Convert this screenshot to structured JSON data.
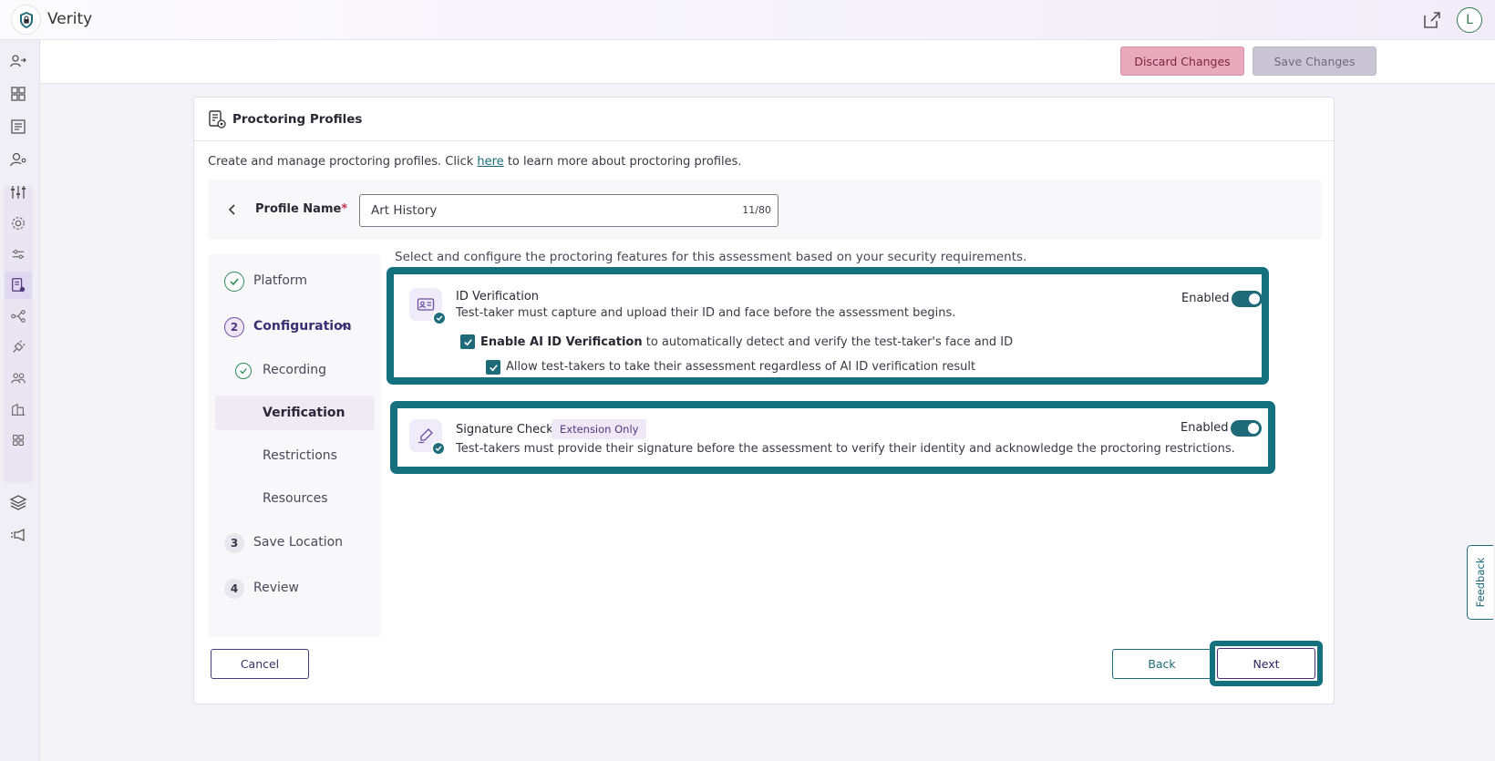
{
  "app": {
    "title": "Verity",
    "avatar_initial": "L"
  },
  "rail": {
    "items": [
      {
        "icon": "user-switch-icon"
      },
      {
        "icon": "grid-icon"
      },
      {
        "icon": "report-icon"
      },
      {
        "icon": "user-search-icon"
      },
      {
        "icon": "sliders-icon"
      },
      {
        "icon": "gear-icon"
      },
      {
        "icon": "filter-sliders-icon"
      },
      {
        "icon": "proctoring-doc-icon"
      },
      {
        "icon": "flow-icon"
      },
      {
        "icon": "plug-icon"
      },
      {
        "icon": "team-icon"
      },
      {
        "icon": "building-icon"
      },
      {
        "icon": "apps-icon"
      },
      {
        "icon": "layers-icon"
      },
      {
        "icon": "announce-icon"
      }
    ]
  },
  "actions": {
    "discard_label": "Discard Changes",
    "save_label": "Save Changes"
  },
  "card": {
    "title": "Proctoring Profiles",
    "intro_before": "Create and manage proctoring profiles. Click ",
    "intro_link": "here",
    "intro_after": " to learn more about proctoring profiles."
  },
  "profile": {
    "label": "Profile Name",
    "required_mark": "*",
    "value": "Art History",
    "count": "11/80"
  },
  "stepper": {
    "platform": "Platform",
    "configuration_num": "2",
    "configuration": "Configuration",
    "recording": "Recording",
    "verification": "Verification",
    "restrictions": "Restrictions",
    "resources": "Resources",
    "save_location_num": "3",
    "save_location": "Save Location",
    "review_num": "4",
    "review": "Review"
  },
  "features_intro": "Select and configure the proctoring features for this assessment based on your security requirements.",
  "id_verification": {
    "title": "ID Verification",
    "description": "Test-taker must capture and upload their ID and face before the assessment begins.",
    "toggle_label": "Enabled",
    "enabled": true,
    "ai_option_bold": "Enable AI ID Verification",
    "ai_option_rest": " to automatically detect and verify the test-taker's face and ID",
    "ai_option_checked": true,
    "allow_option": "Allow test-takers to take their assessment regardless of AI ID verification result",
    "allow_option_checked": true
  },
  "signature_check": {
    "title": "Signature Check",
    "badge": "Extension Only",
    "description": "Test-takers must provide their signature before the assessment to verify their identity and acknowledge the proctoring restrictions.",
    "toggle_label": "Enabled",
    "enabled": true
  },
  "footer": {
    "cancel_label": "Cancel",
    "back_label": "Back",
    "next_label": "Next"
  },
  "feedback_label": "Feedback",
  "colors": {
    "teal": "#1e6a78",
    "purple": "#4d3a7f",
    "discard": "#e8a9bd"
  }
}
